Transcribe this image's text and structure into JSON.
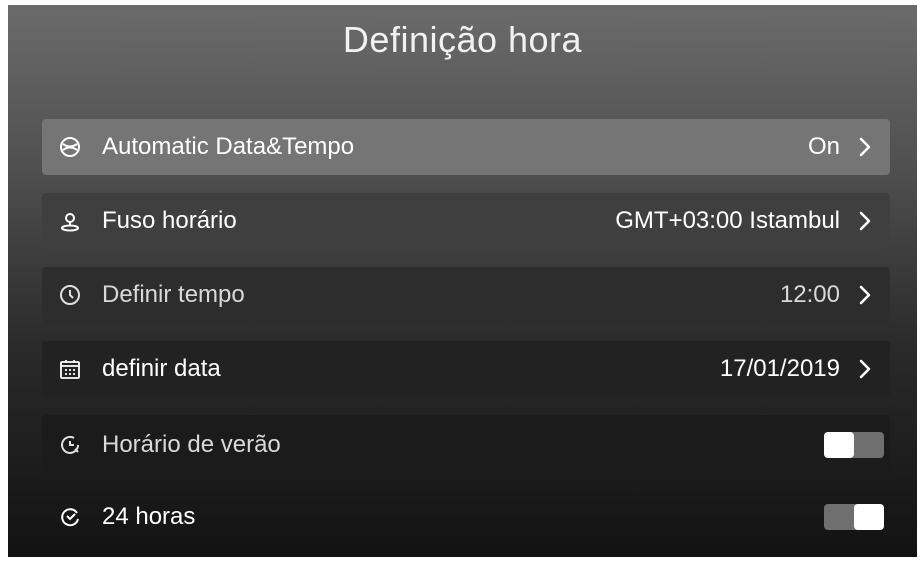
{
  "header": {
    "title": "Definição hora"
  },
  "settings": [
    {
      "label": "Automatic Data&Tempo",
      "value": "On",
      "icon": "auto-time-icon"
    },
    {
      "label": "Fuso horário",
      "value": "GMT+03:00 Istambul",
      "icon": "location-pin-icon"
    },
    {
      "label": "Definir tempo",
      "value": "12:00",
      "icon": "clock-icon"
    },
    {
      "label": "definir data",
      "value": "17/01/2019",
      "icon": "calendar-icon"
    },
    {
      "label": "Horário de verão",
      "toggle": "off",
      "icon": "dst-clock-icon"
    },
    {
      "label": "24 horas",
      "toggle": "on",
      "icon": "clock-24h-icon"
    }
  ]
}
